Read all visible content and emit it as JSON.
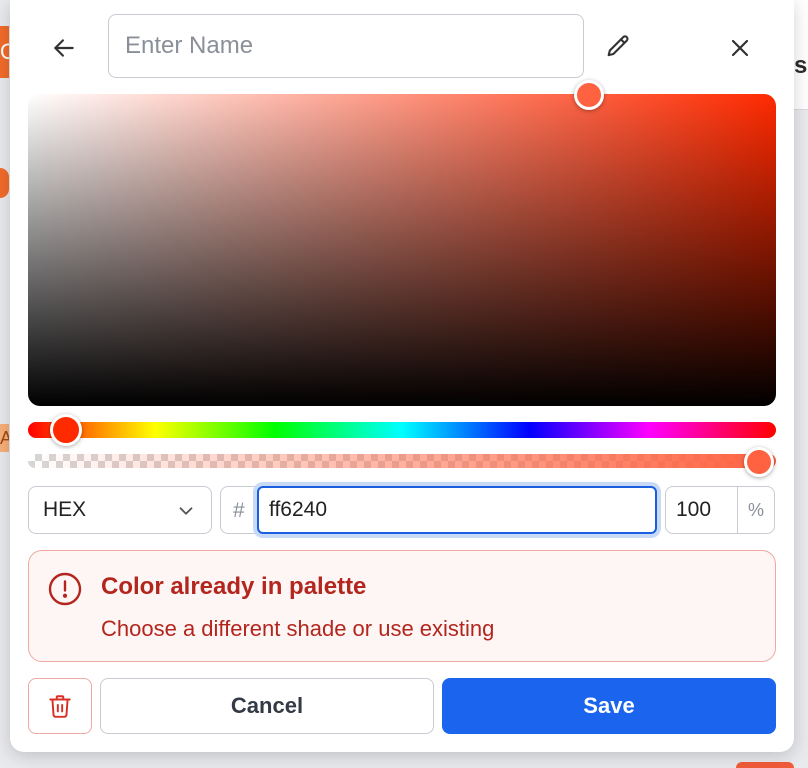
{
  "background": {
    "right_partial_text": "s",
    "left_tab_glyph": "O",
    "left_badge_glyph": "A"
  },
  "header": {
    "name_placeholder": "Enter Name",
    "back_icon": "arrow-left-icon",
    "edit_icon": "pencil-icon",
    "close_icon": "close-icon"
  },
  "picker": {
    "selected_color": "#ff6240",
    "hue_color": "#ff2a00",
    "hue_level": 0.02,
    "alpha_level": 1.0,
    "saturation": 0.75,
    "brightness": 1.0
  },
  "inputs": {
    "format_label": "HEX",
    "hash_symbol": "#",
    "hex_value": "ff6240",
    "alpha_value": "100",
    "alpha_unit": "%"
  },
  "warning": {
    "title": "Color already in palette",
    "message": "Choose a different shade or use existing",
    "color": "#b3261e"
  },
  "actions": {
    "cancel_label": "Cancel",
    "save_label": "Save",
    "save_color": "#1a64ee"
  }
}
